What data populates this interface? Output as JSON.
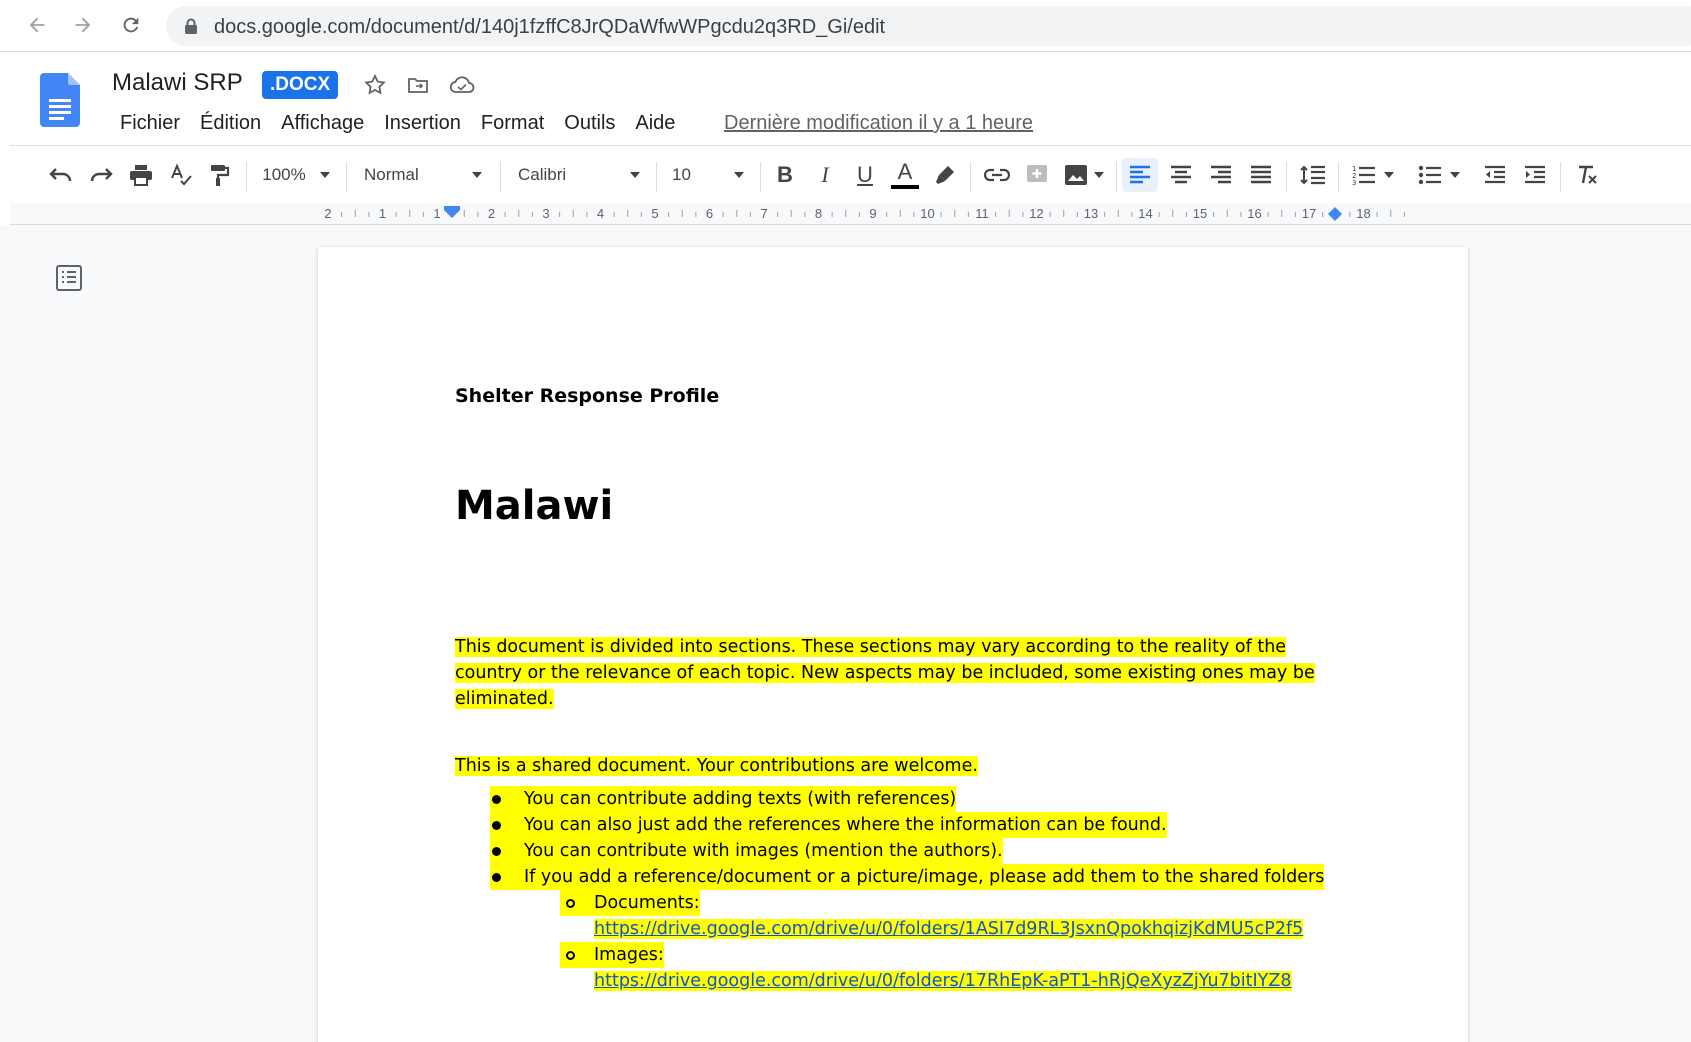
{
  "browser": {
    "url": "docs.google.com/document/d/140j1fzffC8JrQDaWfwWPgcdu2q3RD_Gi/edit"
  },
  "header": {
    "title": "Malawi SRP",
    "badge": ".DOCX",
    "menu": [
      "Fichier",
      "Édition",
      "Affichage",
      "Insertion",
      "Format",
      "Outils",
      "Aide"
    ],
    "last_modified": "Dernière modification il y a 1 heure"
  },
  "toolbar": {
    "zoom": "100%",
    "style": "Normal",
    "font": "Calibri",
    "font_size": "10",
    "bold": "B",
    "italic": "I",
    "underline": "U",
    "text_color": "A"
  },
  "ruler": {
    "labels": [
      "2",
      "1",
      "1",
      "2",
      "3",
      "4",
      "5",
      "6",
      "7",
      "8",
      "9",
      "10",
      "11",
      "12",
      "13",
      "14",
      "15",
      "16",
      "17",
      "18"
    ]
  },
  "document": {
    "header_text": "Shelter Response Profile",
    "heading": "Malawi",
    "intro_lines": [
      "This document is divided into sections. These sections may vary according to the reality of the",
      "country or the relevance of each topic. New aspects may be included, some existing ones may be",
      "eliminated."
    ],
    "shared_note": "This is a shared document. Your contributions are welcome.",
    "bullets": [
      "You can contribute adding texts (with references)",
      "You can also just add the references where the information can be found.",
      "You can contribute with images (mention the authors).",
      "If you add a reference/document or a picture/image, please add them to the shared folders"
    ],
    "sub_bullets": [
      {
        "label": "Documents:",
        "link": "https://drive.google.com/drive/u/0/folders/1ASI7d9RL3JsxnQpokhqizjKdMU5cP2f5"
      },
      {
        "label": "Images:",
        "link": "https://drive.google.com/drive/u/0/folders/17RhEpK-aPT1-hRjQeXyzZjYu7bitIYZ8"
      }
    ]
  },
  "colors": {
    "highlight": "#ffff00",
    "docs_blue": "#4285f4",
    "link": "#1155cc"
  }
}
